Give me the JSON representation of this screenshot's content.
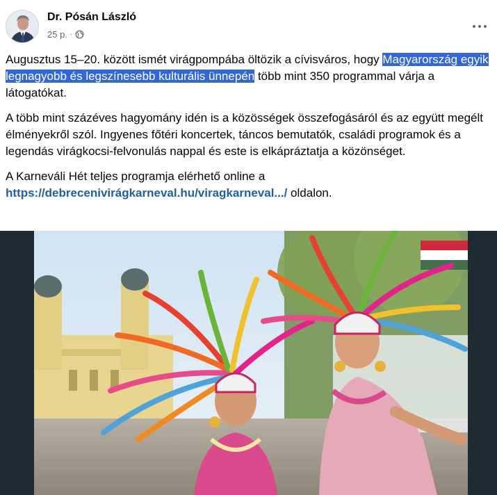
{
  "post": {
    "author": "Dr. Pósán László",
    "time": "25 p.",
    "separator": "·",
    "privacy_icon": "globe-icon",
    "more_icon": "more-horizontal-icon",
    "paragraph1": {
      "before": "Augusztus 15–20. között ismét virágpompába öltözik a cívisváros, hogy ",
      "highlight": "Magyarország egyik legnagyobb és legszínesebb kulturális ünnepén",
      "after": " több mint 350 programmal várja a látogatókat."
    },
    "paragraph2": "A több mint százéves hagyomány idén is a közösségek összefogásáról és az együtt megélt élményekről szól. Ingyenes főtéri koncertek, táncos bemutatók, családi programok és a legendás virágkocsi-felvonulás nappal és este is elkápráztatja a közönséget.",
    "paragraph3": {
      "before": "A Karneváli Hét teljes programja elérhető online a ",
      "link": "https://debrecenivirágkarneval.hu/viragkarneval.../",
      "after": " oldalon."
    }
  },
  "colors": {
    "highlight_bg": "#3367d6",
    "link": "#1f5fa8",
    "secondary_text": "#65676b",
    "photo_frame": "#1f2b33"
  }
}
